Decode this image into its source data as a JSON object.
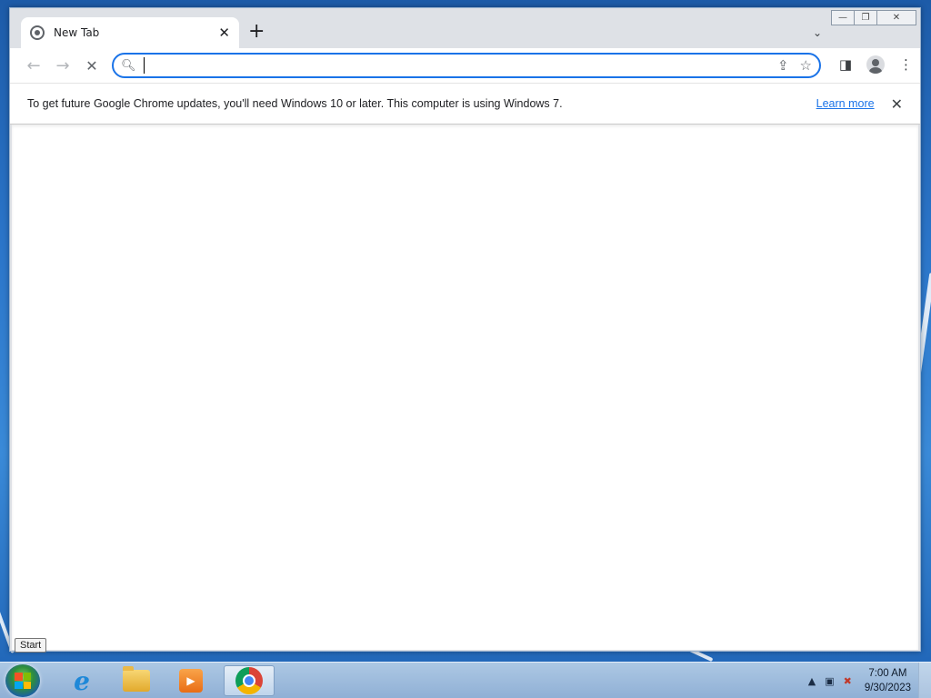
{
  "browser": {
    "tab": {
      "title": "New Tab"
    },
    "window_controls": {
      "minimize": "—",
      "maximize": "❐",
      "close": "✕"
    },
    "omnibox": {
      "value": "",
      "placeholder": ""
    },
    "infobar": {
      "message": "To get future Google Chrome updates, you'll need Windows 10 or later. This computer is using Windows 7.",
      "link": "Learn more"
    }
  },
  "tooltip": {
    "text": "Start"
  },
  "taskbar": {
    "clock_time": "7:00 AM",
    "clock_date": "9/30/2023",
    "media_glyph": "▶"
  },
  "colors": {
    "accent": "#1a73e8",
    "tab_strip": "#dee1e6"
  },
  "icons": [
    "back-arrow-icon",
    "forward-arrow-icon",
    "stop-icon",
    "search-icon",
    "share-icon",
    "star-icon",
    "side-panel-icon",
    "profile-icon",
    "more-menu-icon",
    "close-icon",
    "plus-icon",
    "chevron-down-icon",
    "globe-icon"
  ]
}
